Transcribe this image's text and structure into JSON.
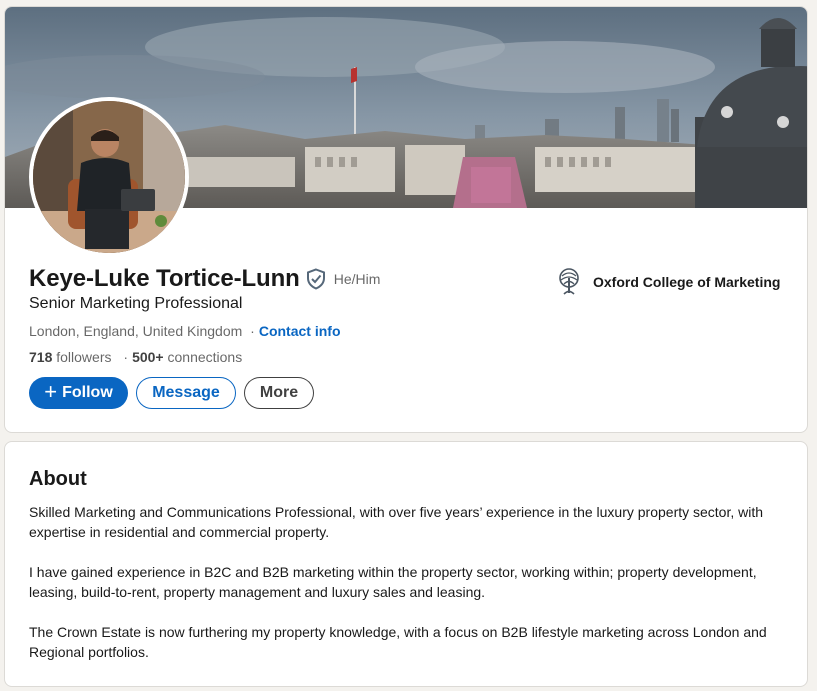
{
  "profile": {
    "name": "Keye-Luke Tortice-Lunn",
    "verified_icon": "verified-shield-icon",
    "pronouns": "He/Him",
    "headline": "Senior Marketing Professional",
    "location": "London, England, United Kingdom",
    "location_separator": "·",
    "contact_info_label": "Contact info",
    "followers_count": "718",
    "followers_label": "followers",
    "connections_separator": "·",
    "connections_count": "500+",
    "connections_label": "connections",
    "education": {
      "logo_icon": "oxford-college-tree-logo",
      "name": "Oxford College of Marketing"
    }
  },
  "actions": {
    "follow_icon": "plus-icon",
    "follow_label": "Follow",
    "message_label": "Message",
    "more_label": "More"
  },
  "about": {
    "title": "About",
    "paragraphs": [
      "Skilled Marketing and Communications Professional, with over five years’ experience in the luxury property sector, with expertise in residential and commercial property.",
      "I have gained experience in B2C and B2B marketing within the property sector, working within; property development, leasing, build-to-rent, property management and luxury sales and leasing.",
      "The Crown Estate is now furthering my property knowledge, with a focus on B2B lifestyle marketing across London and Regional portfolios."
    ]
  },
  "colors": {
    "brand_blue": "#0a66c2",
    "page_background": "#f4f2ee",
    "card_background": "#ffffff"
  }
}
